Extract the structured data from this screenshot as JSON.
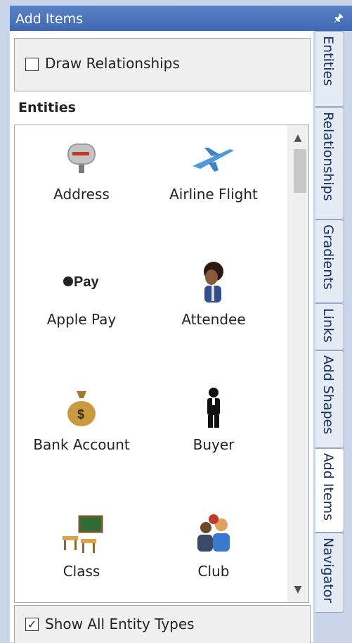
{
  "title_bar": {
    "title": "Add Items",
    "pin_icon": "pin-icon"
  },
  "draw_relationships": {
    "label": "Draw Relationships",
    "checked": false
  },
  "entities_header": "Entities",
  "entities": [
    {
      "label": "Address",
      "icon": "mailbox-icon"
    },
    {
      "label": "Airline Flight",
      "icon": "airplane-icon"
    },
    {
      "label": "Apple Pay",
      "icon": "apple-pay-icon",
      "icon_text": "Pay"
    },
    {
      "label": "Attendee",
      "icon": "person-icon"
    },
    {
      "label": "Bank Account",
      "icon": "money-bag-icon"
    },
    {
      "label": "Buyer",
      "icon": "buyer-person-icon"
    },
    {
      "label": "Class",
      "icon": "classroom-icon"
    },
    {
      "label": "Club",
      "icon": "group-icon"
    }
  ],
  "show_all": {
    "label": "Show All Entity Types",
    "checked": true
  },
  "side_tabs": [
    {
      "label": "Entities"
    },
    {
      "label": "Relationships"
    },
    {
      "label": "Gradients"
    },
    {
      "label": "Links"
    },
    {
      "label": "Add Shapes"
    },
    {
      "label": "Add Items",
      "active": true
    },
    {
      "label": "Navigator"
    }
  ],
  "colors": {
    "title_bar": "#4a74bc",
    "tab_text": "#1a2f57",
    "panel_bg": "#f0f0f0"
  }
}
